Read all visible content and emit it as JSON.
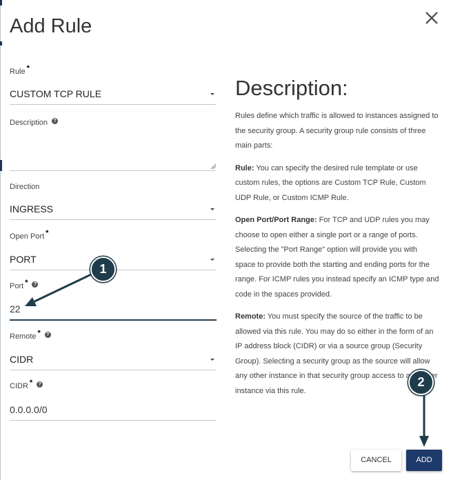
{
  "dialog": {
    "title": "Add Rule"
  },
  "form": {
    "rule": {
      "label": "Rule",
      "value": "CUSTOM TCP RULE"
    },
    "description": {
      "label": "Description",
      "value": ""
    },
    "direction": {
      "label": "Direction",
      "value": "INGRESS"
    },
    "open_port": {
      "label": "Open Port",
      "value": "PORT"
    },
    "port": {
      "label": "Port",
      "value": "22"
    },
    "remote": {
      "label": "Remote",
      "value": "CIDR"
    },
    "cidr": {
      "label": "CIDR",
      "value": "0.0.0.0/0"
    }
  },
  "description_panel": {
    "title": "Description:",
    "intro": "Rules define which traffic is allowed to instances assigned to the security group. A security group rule consists of three main parts:",
    "rule_heading": "Rule:",
    "rule_text": " You can specify the desired rule template or use custom rules, the options are Custom TCP Rule, Custom UDP Rule, or Custom ICMP Rule.",
    "port_heading": "Open Port/Port Range:",
    "port_text": " For TCP and UDP rules you may choose to open either a single port or a range of ports. Selecting the \"Port Range\" option will provide you with space to provide both the starting and ending ports for the range. For ICMP rules you instead specify an ICMP type and code in the spaces provided.",
    "remote_heading": "Remote:",
    "remote_text": " You must specify the source of the traffic to be allowed via this rule. You may do so either in the form of an IP address block (CIDR) or via a source group (Security Group). Selecting a security group as the source will allow any other instance in that security group access to any other instance via this rule."
  },
  "buttons": {
    "cancel": "CANCEL",
    "add": "ADD"
  },
  "annotations": {
    "step1": "1",
    "step2": "2"
  },
  "colors": {
    "primary": "#1d3a6b",
    "annotation": "#1f3c4a",
    "required": "#000000"
  },
  "icons": {
    "close": "close-icon",
    "help": "help-icon",
    "dropdown": "caret-down-icon",
    "resize": "resize-grip-icon"
  }
}
